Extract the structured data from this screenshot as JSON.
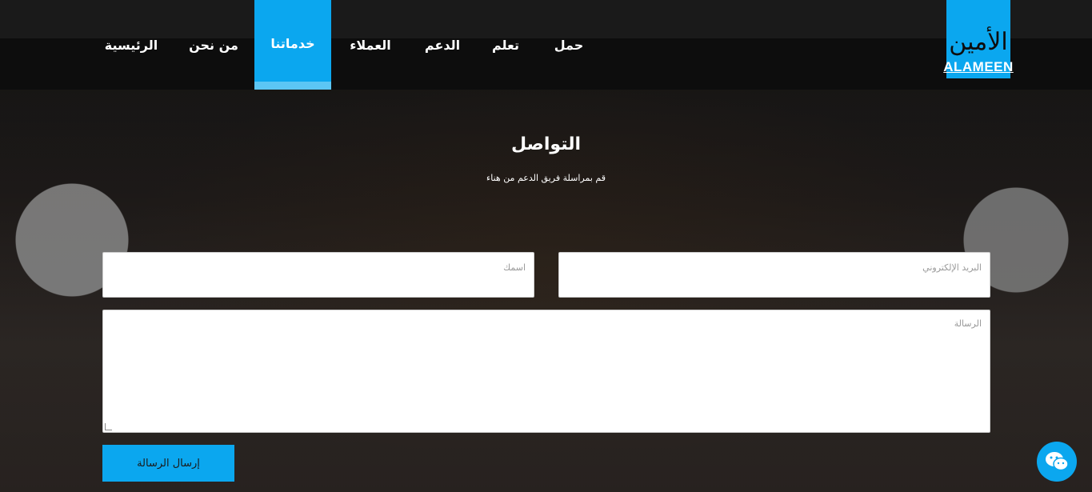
{
  "nav": {
    "items": [
      {
        "label": "حمل"
      },
      {
        "label": "تعلم"
      },
      {
        "label": "الدعم"
      },
      {
        "label": "العملاء"
      },
      {
        "label": "خدماتنا",
        "active": true
      },
      {
        "label": "من نحن"
      },
      {
        "label": "الرئيسية"
      }
    ]
  },
  "logo": {
    "arabic": "الأمين",
    "english": "ALAMEEN"
  },
  "contact": {
    "title": "التواصل",
    "subtitle": "قم بمراسلة فريق الدعم من هناء",
    "email_placeholder": "البريد الإلكتروني",
    "name_placeholder": "اسمك",
    "message_placeholder": "الرسالة",
    "submit_label": "إرسال الرسالة"
  },
  "colors": {
    "accent": "#0ba7ef",
    "nav_bg": "#0d0d0d"
  },
  "icons": {
    "chat": "chat-bubbles-icon"
  }
}
